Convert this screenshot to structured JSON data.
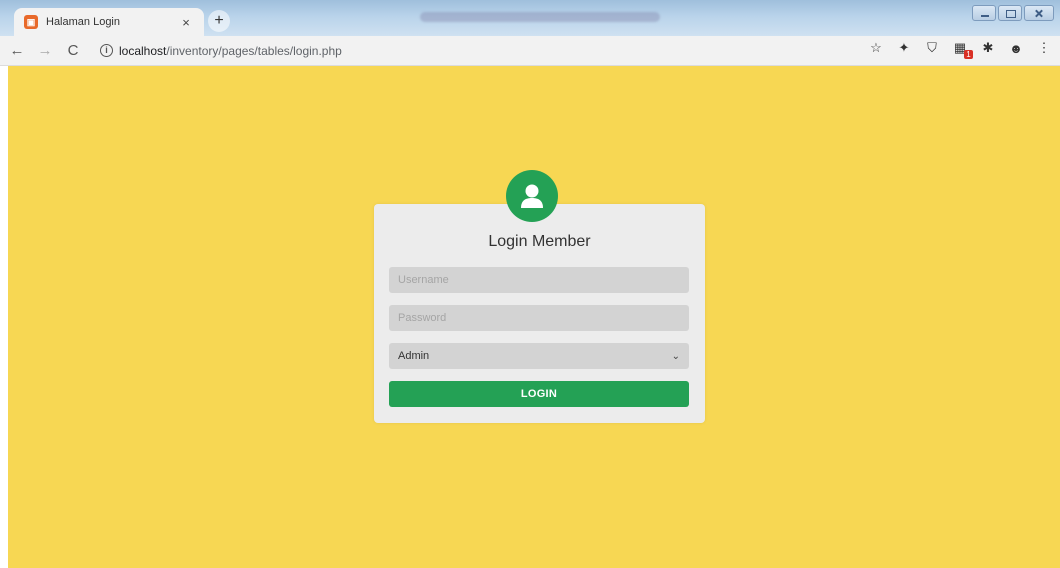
{
  "browser": {
    "tab": {
      "title": "Halaman Login",
      "close": "×",
      "favicon": "app-favicon-icon"
    },
    "new_tab": "+",
    "nav": {
      "back": "←",
      "forward": "→",
      "reload": "C",
      "info": "i"
    },
    "address": {
      "host": "localhost",
      "path": "/inventory/pages/tables/login.php"
    },
    "extensions": [
      "star-icon",
      "extension-pin-icon",
      "shield-extension-icon",
      "badge-extension-icon",
      "puzzle-icon",
      "profile-avatar-icon",
      "menu-dots-icon"
    ]
  },
  "login": {
    "title": "Login Member",
    "username_placeholder": "Username",
    "password_placeholder": "Password",
    "role_selected": "Admin",
    "button_label": "LOGIN"
  },
  "colors": {
    "page_background": "#f7d753",
    "card_background": "#ececec",
    "accent_green": "#24a155",
    "field_background": "#d3d3d3"
  }
}
